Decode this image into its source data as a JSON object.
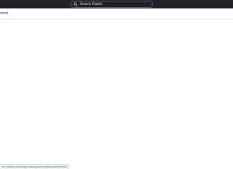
{
  "search": {
    "placeholder": "Search Elastic"
  },
  "header": {
    "title": "ment"
  },
  "status_bar": {
    "url": "sm.elastic.cloud/app/management/kibana/dataViews"
  },
  "colors": {
    "topbar_bg": "#1f2126",
    "search_border": "#5c616b",
    "page_bg": "#ffffff"
  }
}
